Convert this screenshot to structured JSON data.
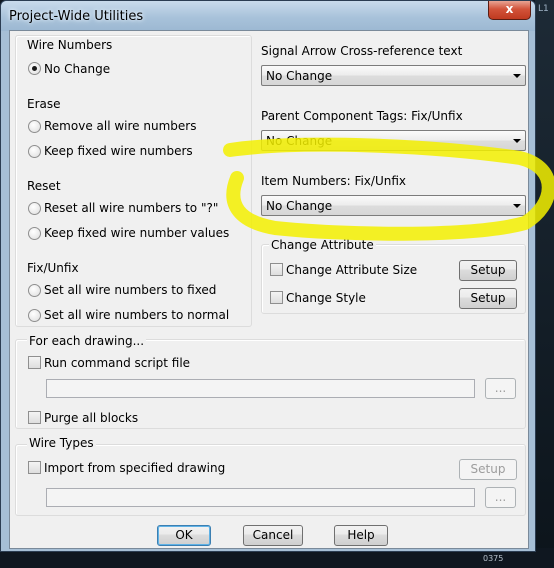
{
  "window": {
    "title": "Project-Wide Utilities",
    "close_glyph": "x"
  },
  "wire_numbers": {
    "title": "Wire Numbers",
    "no_change": "No Change",
    "erase_title": "Erase",
    "erase_remove_all": "Remove all wire numbers",
    "erase_keep_fixed": "Keep fixed wire numbers",
    "reset_title": "Reset",
    "reset_all": "Reset all wire numbers to \"?\"",
    "reset_keep_fixed": "Keep fixed wire number values",
    "fix_title": "Fix/Unfix",
    "fix_all": "Set all wire numbers to fixed",
    "fix_normal": "Set all wire numbers to normal"
  },
  "signal_arrow": {
    "label": "Signal Arrow Cross-reference text",
    "value": "No Change"
  },
  "parent_tags": {
    "label": "Parent Component Tags: Fix/Unfix",
    "value": "No Change"
  },
  "item_numbers": {
    "label": "Item Numbers: Fix/Unfix",
    "value": "No Change"
  },
  "change_attribute": {
    "title": "Change Attribute",
    "size_label": "Change Attribute Size",
    "style_label": "Change Style",
    "setup_label": "Setup"
  },
  "each_drawing": {
    "title": "For each drawing...",
    "run_script": "Run command script file",
    "browse_label": "...",
    "purge_blocks": "Purge all blocks"
  },
  "wire_types": {
    "title": "Wire Types",
    "import_label": "Import from specified drawing",
    "setup_label": "Setup",
    "browse_label": "..."
  },
  "buttons": {
    "ok": "OK",
    "cancel": "Cancel",
    "help": "Help"
  },
  "background": {
    "side_label": "L1",
    "coord": "0375"
  },
  "colors": {
    "highlight": "#f3f000",
    "title_bg": "#a6bfd6",
    "close": "#c9442a"
  }
}
